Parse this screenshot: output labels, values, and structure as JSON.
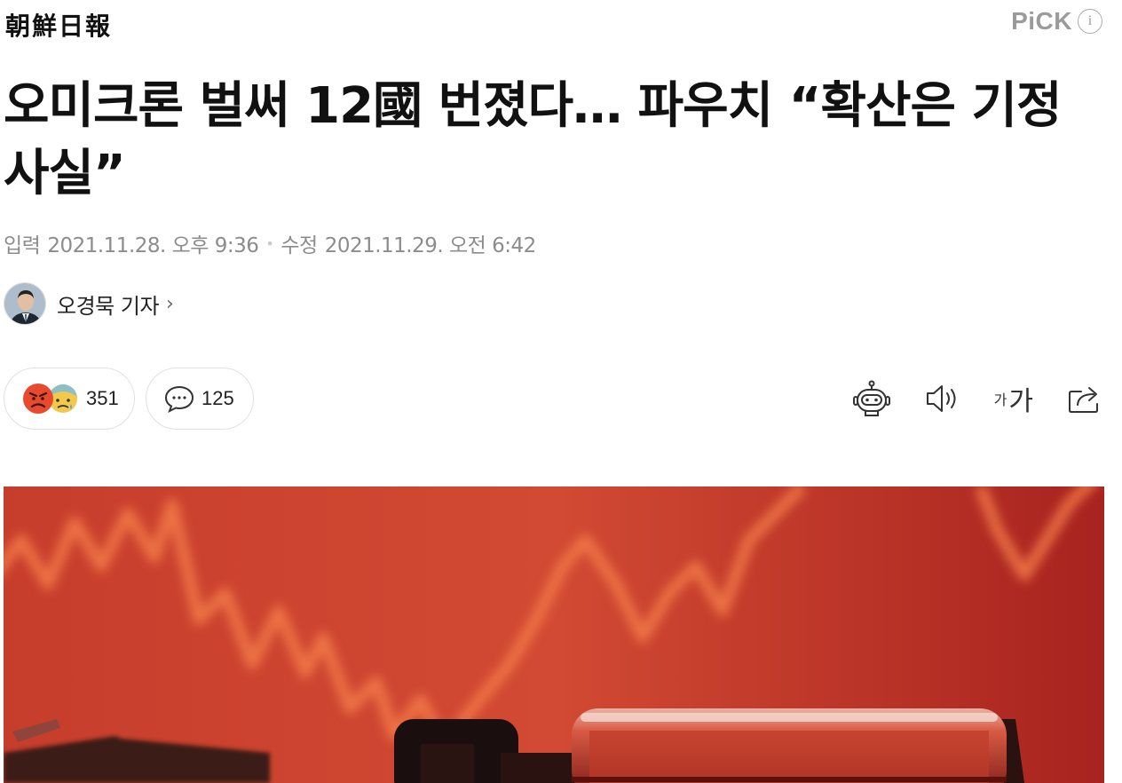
{
  "header": {
    "masthead": "朝鮮日報",
    "pick_label": "PiCK",
    "info_glyph": "i"
  },
  "article": {
    "headline": "오미크론 벌써 12國 번졌다… 파우치 “확산은 기정사실”",
    "input_label": "입력",
    "input_time": "2021.11.28. 오후 9:36",
    "separator": "•",
    "update_label": "수정",
    "update_time": "2021.11.29. 오전 6:42",
    "author": "오경묵 기자",
    "author_chevron": "›"
  },
  "reactions": {
    "count": "351",
    "icons": [
      "angry-face-icon",
      "sad-face-icon"
    ]
  },
  "comments": {
    "count": "125",
    "icon": "speech-bubble-icon"
  },
  "tools": {
    "icons": [
      "robot-summary-icon",
      "speaker-icon",
      "font-size-icon",
      "share-icon"
    ],
    "font_small": "가",
    "font_large": "가"
  },
  "colors": {
    "text": "#111111",
    "muted": "#8c8c8c",
    "pick": "#9b9b9b",
    "hero_red": "#c83a2c",
    "chart_line": "#f07a45"
  }
}
